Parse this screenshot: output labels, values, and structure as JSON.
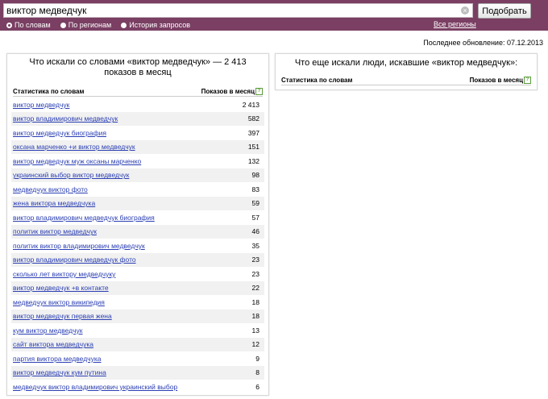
{
  "search": {
    "value": "виктор медведчук",
    "button": "Подобрать",
    "clear": "×"
  },
  "modes": [
    {
      "label": "По словам",
      "selected": true
    },
    {
      "label": "По регионам",
      "selected": false
    },
    {
      "label": "История запросов",
      "selected": false
    }
  ],
  "all_regions": "Все регионы",
  "last_update": "Последнее обновление: 07.12.2013",
  "left_panel": {
    "title": "Что искали со словами «виктор медведчук» — 2 413 показов в месяц",
    "col_words": "Статистика по словам",
    "col_shows": "Показов в месяц",
    "rows": [
      {
        "q": "виктор медведчук",
        "n": "2 413"
      },
      {
        "q": "виктор владимирович медведчук",
        "n": "582"
      },
      {
        "q": "виктор медведчук биография",
        "n": "397"
      },
      {
        "q": "оксана марченко +и виктор медведчук",
        "n": "151"
      },
      {
        "q": "виктор медведчук муж оксаны марченко",
        "n": "132"
      },
      {
        "q": "украинский выбор виктор медведчук",
        "n": "98"
      },
      {
        "q": "медведчук виктор фото",
        "n": "83"
      },
      {
        "q": "жена виктора медведчука",
        "n": "59"
      },
      {
        "q": "виктор владимирович медведчук биография",
        "n": "57"
      },
      {
        "q": "политик виктор медведчук",
        "n": "46"
      },
      {
        "q": "политик виктор владимирович медведчук",
        "n": "35"
      },
      {
        "q": "виктор владимирович медведчук фото",
        "n": "23"
      },
      {
        "q": "сколько лет виктору медведчуку",
        "n": "23"
      },
      {
        "q": "виктор медведчук +в контакте",
        "n": "22"
      },
      {
        "q": "медведчук виктор википедия",
        "n": "18"
      },
      {
        "q": "виктор медведчук первая жена",
        "n": "18"
      },
      {
        "q": "кум виктор медведчук",
        "n": "13"
      },
      {
        "q": "сайт виктора медведчука",
        "n": "12"
      },
      {
        "q": "партия виктора медведчука",
        "n": "9"
      },
      {
        "q": "виктор медведчук кум путина",
        "n": "8"
      },
      {
        "q": "медведчук виктор владимирович украинский выбор",
        "n": "6"
      }
    ]
  },
  "right_panel": {
    "title": "Что еще искали люди, искавшие «виктор медведчук»:",
    "col_words": "Статистика по словам",
    "col_shows": "Показов в месяц"
  },
  "help_mark": "?"
}
